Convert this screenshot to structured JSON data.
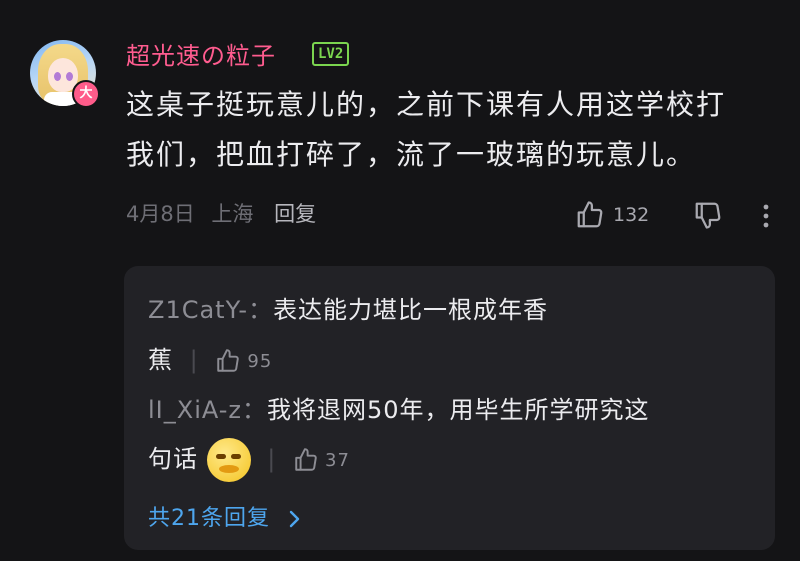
{
  "user": {
    "name": "超光速の粒子",
    "level": "LV2",
    "avatar_badge": "大"
  },
  "comment": {
    "line1": "这桌子挺玩意儿的，之前下课有人用这学校打",
    "line2": "我们，把血打碎了，流了一玻璃的玩意儿。",
    "date": "4月8日",
    "location": "上海",
    "reply_label": "回复",
    "likes": "132"
  },
  "replies": [
    {
      "user": "Z1CatY-",
      "sep": "：",
      "text_line1": "表达能力堪比一根成年香",
      "text_line2": "蕉",
      "likes": "95"
    },
    {
      "user": "lI_XiA-z",
      "sep": "：",
      "text_line1": "我将退网50年，用毕生所学研究这",
      "text_line2": "句话",
      "likes": "37",
      "emoji": "smug-face-emoji"
    }
  ],
  "replies_total": "共21条回复",
  "colors": {
    "username": "#ff5c8f",
    "level": "#7bd54f",
    "link": "#4ea6ee",
    "background": "#141416",
    "reply_panel": "#222226"
  }
}
